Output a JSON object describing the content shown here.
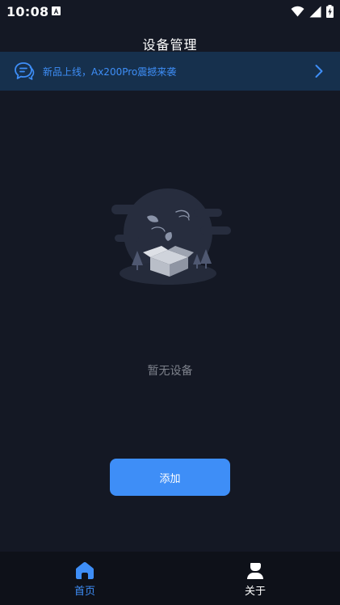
{
  "status_bar": {
    "time": "10:08",
    "icons": [
      "a-notification-icon",
      "wifi-icon",
      "cellular-signal-icon",
      "battery-charging-icon"
    ]
  },
  "header": {
    "title": "设备管理"
  },
  "notice": {
    "text": "新品上线，Ax200Pro震撼来袭",
    "icon": "message-bubble-icon",
    "arrow_icon": "chevron-right-icon",
    "accent_color": "#3e8ef7"
  },
  "empty_state": {
    "illustration": "empty-box-illustration",
    "message": "暂无设备"
  },
  "actions": {
    "add_label": "添加"
  },
  "tab_bar": {
    "active_color": "#3e8ef7",
    "items": [
      {
        "label": "首页",
        "icon": "home-icon",
        "active": true
      },
      {
        "label": "关于",
        "icon": "person-icon",
        "active": false
      }
    ]
  },
  "colors": {
    "background": "#141824",
    "notice_background": "#16304d",
    "button": "#3e8ef7",
    "muted_text": "#7c808a"
  }
}
